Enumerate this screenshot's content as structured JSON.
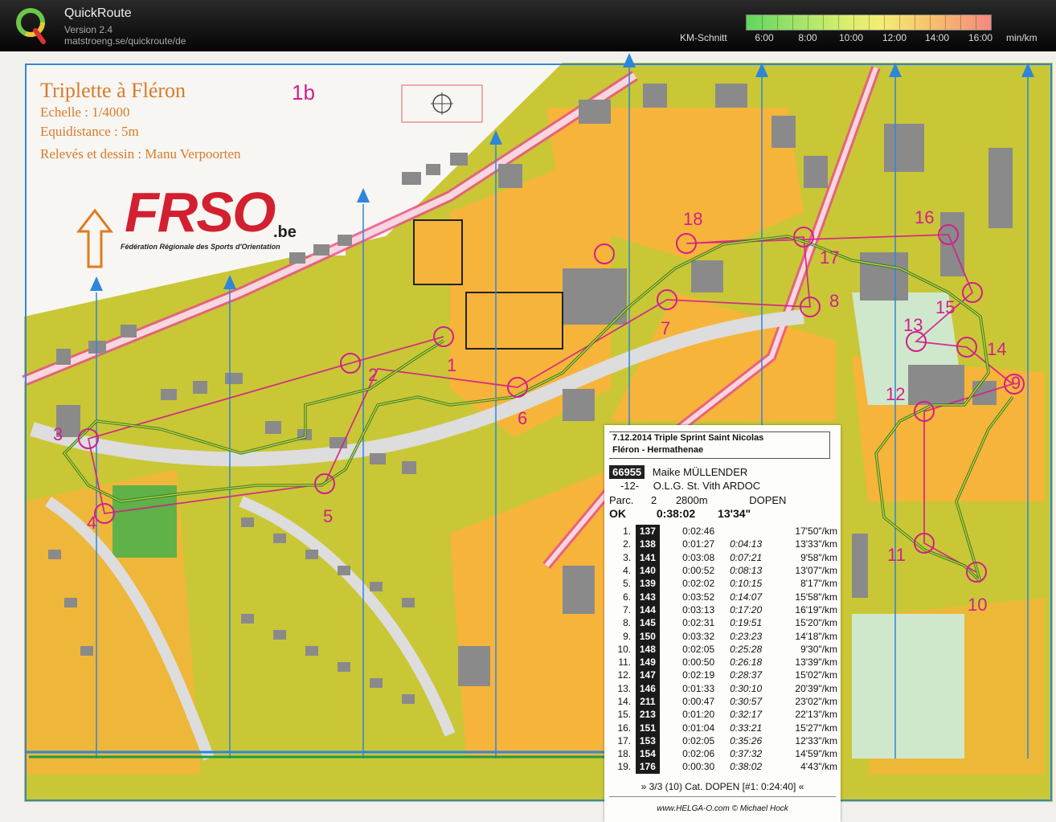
{
  "app": {
    "title": "QuickRoute",
    "version": "Version 2.4",
    "url": "matstroeng.se/quickroute/de",
    "legend_label": "KM-Schnitt",
    "legend_ticks": [
      "6:00",
      "8:00",
      "10:00",
      "12:00",
      "14:00",
      "16:00"
    ],
    "legend_unit": "min/km",
    "icons": [
      "quickroute-logo-icon"
    ]
  },
  "map": {
    "title": "Triplette à Fléron",
    "scale": "Echelle : 1/4000",
    "equidistance": "Equidistance : 5m",
    "author": "Relevés et dessin : Manu Verpoorten",
    "course_id": "1b",
    "frso_logo": "FRSO",
    "frso_domain": ".be",
    "frso_subtitle": "Fédération Régionale des Sports d'Orientation",
    "controls": [
      "1",
      "2",
      "3",
      "4",
      "5",
      "6",
      "7",
      "8",
      "9",
      "10",
      "11",
      "12",
      "13",
      "14",
      "15",
      "16",
      "17",
      "18"
    ],
    "colors": {
      "route": "#1f7a1f",
      "course": "#d21f8b",
      "north_lines": "#2e86d9",
      "open_land": "#f6b43a",
      "rough_open": "#c9c736"
    }
  },
  "splits": {
    "date_event": "7.12.2014   Triple Sprint Saint Nicolas",
    "location": "Fléron - Hermathenae",
    "runner_id": "66955",
    "runner_name": "Maike MÜLLENDER",
    "runner_num": "-12-",
    "club": "O.L.G. St. Vith ARDOC",
    "parc_label": "Parc.",
    "parc_num": "2",
    "distance": "2800m",
    "category": "DOPEN",
    "status": "OK",
    "total_time": "0:38:02",
    "avg_pace": "13'34\"",
    "rows": [
      {
        "no": "1.",
        "code": "137",
        "leg": "0:02:46",
        "cum": "",
        "pace": "17'50\"/km"
      },
      {
        "no": "2.",
        "code": "138",
        "leg": "0:01:27",
        "cum": "0:04:13",
        "pace": "13'33\"/km"
      },
      {
        "no": "3.",
        "code": "141",
        "leg": "0:03:08",
        "cum": "0:07:21",
        "pace": "9'58\"/km"
      },
      {
        "no": "4.",
        "code": "140",
        "leg": "0:00:52",
        "cum": "0:08:13",
        "pace": "13'07\"/km"
      },
      {
        "no": "5.",
        "code": "139",
        "leg": "0:02:02",
        "cum": "0:10:15",
        "pace": "8'17\"/km"
      },
      {
        "no": "6.",
        "code": "143",
        "leg": "0:03:52",
        "cum": "0:14:07",
        "pace": "15'58\"/km"
      },
      {
        "no": "7.",
        "code": "144",
        "leg": "0:03:13",
        "cum": "0:17:20",
        "pace": "16'19\"/km"
      },
      {
        "no": "8.",
        "code": "145",
        "leg": "0:02:31",
        "cum": "0:19:51",
        "pace": "15'20\"/km"
      },
      {
        "no": "9.",
        "code": "150",
        "leg": "0:03:32",
        "cum": "0:23:23",
        "pace": "14'18\"/km"
      },
      {
        "no": "10.",
        "code": "148",
        "leg": "0:02:05",
        "cum": "0:25:28",
        "pace": "9'30\"/km"
      },
      {
        "no": "11.",
        "code": "149",
        "leg": "0:00:50",
        "cum": "0:26:18",
        "pace": "13'39\"/km"
      },
      {
        "no": "12.",
        "code": "147",
        "leg": "0:02:19",
        "cum": "0:28:37",
        "pace": "15'02\"/km"
      },
      {
        "no": "13.",
        "code": "146",
        "leg": "0:01:33",
        "cum": "0:30:10",
        "pace": "20'39\"/km"
      },
      {
        "no": "14.",
        "code": "211",
        "leg": "0:00:47",
        "cum": "0:30:57",
        "pace": "23'02\"/km"
      },
      {
        "no": "15.",
        "code": "213",
        "leg": "0:01:20",
        "cum": "0:32:17",
        "pace": "22'13\"/km"
      },
      {
        "no": "16.",
        "code": "151",
        "leg": "0:01:04",
        "cum": "0:33:21",
        "pace": "15'27\"/km"
      },
      {
        "no": "17.",
        "code": "153",
        "leg": "0:02:05",
        "cum": "0:35:26",
        "pace": "12'33\"/km"
      },
      {
        "no": "18.",
        "code": "154",
        "leg": "0:02:06",
        "cum": "0:37:32",
        "pace": "14'59\"/km"
      },
      {
        "no": "19.",
        "code": "176",
        "leg": "0:00:30",
        "cum": "0:38:02",
        "pace": "4'43\"/km"
      }
    ],
    "footer": "» 3/3 (10) Cat. DOPEN [#1: 0:24:40] «",
    "credit": "www.HELGA-O.com © Michael Hock"
  }
}
